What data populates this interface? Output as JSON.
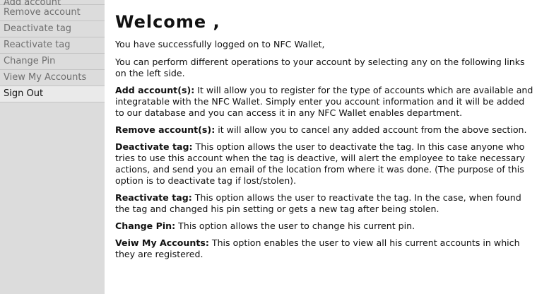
{
  "sidebar": {
    "items": [
      {
        "label": "Add account",
        "active": false
      },
      {
        "label": "Remove account",
        "active": false
      },
      {
        "label": "Deactivate tag",
        "active": false
      },
      {
        "label": "Reactivate tag",
        "active": false
      },
      {
        "label": "Change Pin",
        "active": false
      },
      {
        "label": "View My Accounts",
        "active": false
      },
      {
        "label": "Sign Out",
        "active": true
      }
    ]
  },
  "main": {
    "title": "Welcome ,",
    "intro": "You have successfully logged on to NFC Wallet,",
    "instructions": "You can perform different operations to your account by selecting any on the following links on the left side.",
    "sections": [
      {
        "heading": "Add account(s):",
        "text": " It will allow you to register for the type of accounts which are available and integratable with the NFC Wallet. Simply enter you account information and it will be added to our database and you can access it in any NFC Wallet enables department."
      },
      {
        "heading": "Remove account(s):",
        "text": " it will allow you to cancel any added account from the above section."
      },
      {
        "heading": "Deactivate tag:",
        "text": " This option allows the user to deactivate the tag. In this case anyone who tries to use this account when the tag is deactive, will alert the employee to take necessary actions, and send you an email of the location from where it was done. (The purpose of this option is to deactivate tag if lost/stolen)."
      },
      {
        "heading": "Reactivate tag:",
        "text": " This option allows the user to reactivate the tag. In the case, when found the tag and changed his pin setting or gets a new tag after being stolen."
      },
      {
        "heading": "Change Pin:",
        "text": " This option allows the user to change his current pin."
      },
      {
        "heading": "Veiw My Accounts:",
        "text": " This option enables the user to view all his current accounts in which they are registered."
      }
    ]
  }
}
